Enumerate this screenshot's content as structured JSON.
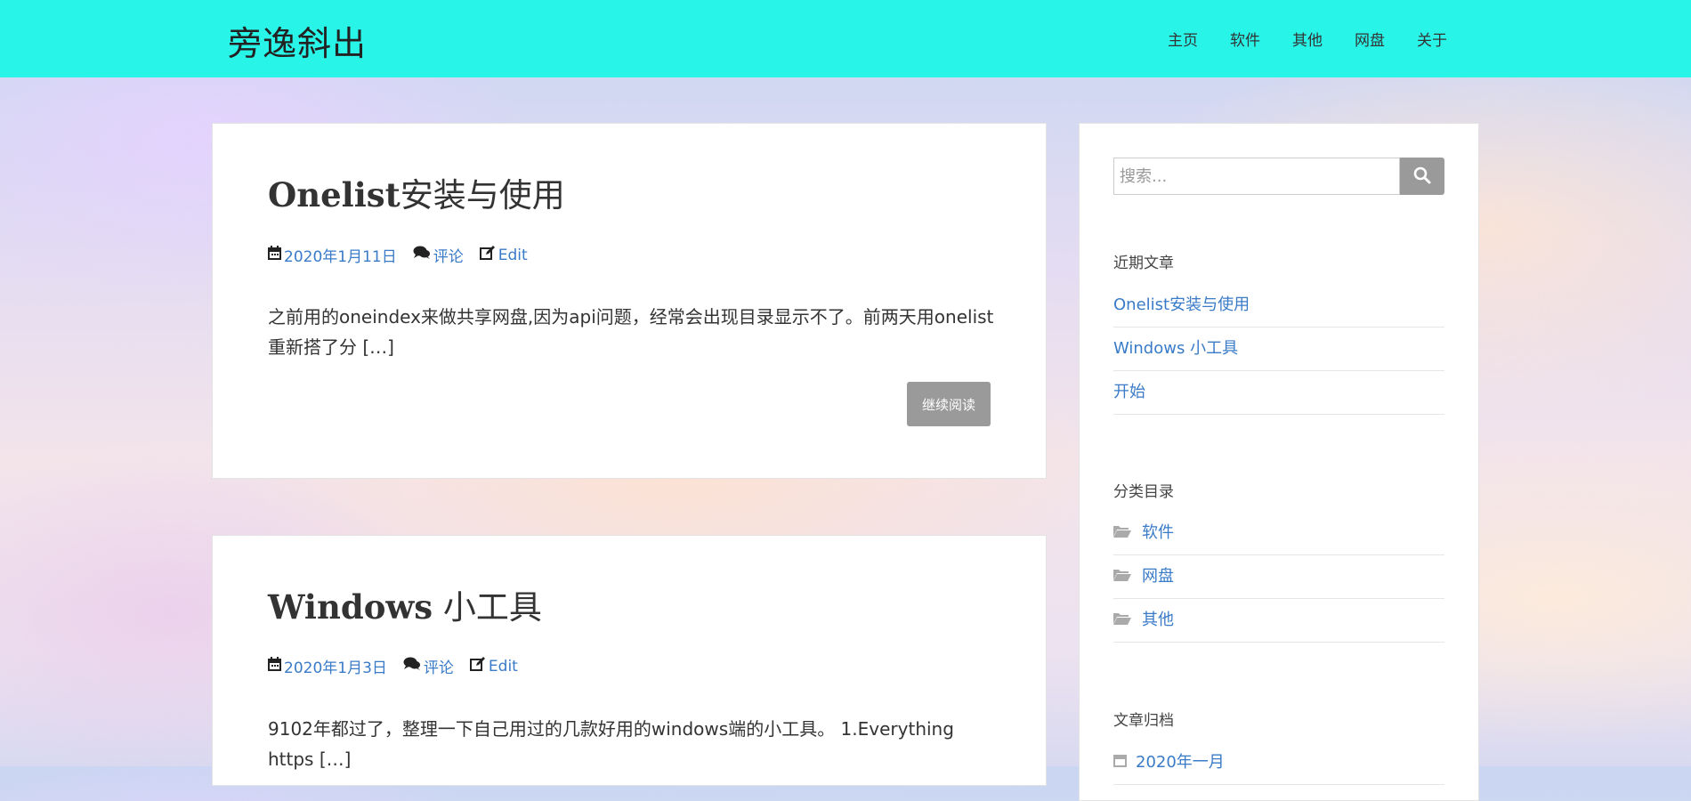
{
  "header": {
    "brand": "旁逸斜出",
    "nav": [
      "主页",
      "软件",
      "其他",
      "网盘",
      "关于"
    ]
  },
  "posts": [
    {
      "title_latin": "Onelist",
      "title_cjk": "安装与使用",
      "date": "2020年1月11日",
      "comments": "评论",
      "edit": "Edit",
      "excerpt": "之前用的oneindex来做共享网盘,因为api问题，经常会出现目录显示不了。前两天用onelist重新搭了分 […]",
      "more": "继续阅读"
    },
    {
      "title_latin": "Windows",
      "title_cjk": " 小工具",
      "date": "2020年1月3日",
      "comments": "评论",
      "edit": "Edit",
      "excerpt": "9102年都过了，整理一下自己用过的几款好用的windows端的小工具。 1.Everything https […]"
    }
  ],
  "sidebar": {
    "search_placeholder": "搜索...",
    "recent_title": "近期文章",
    "recent": [
      "Onelist安装与使用",
      "Windows 小工具",
      "开始"
    ],
    "categories_title": "分类目录",
    "categories": [
      "软件",
      "网盘",
      "其他"
    ],
    "archives_title": "文章归档",
    "archives": [
      "2020年一月"
    ]
  },
  "colors": {
    "header_bg": "#28f4e8",
    "link": "#3a7bc8",
    "button_bg": "#9a9a9a"
  }
}
